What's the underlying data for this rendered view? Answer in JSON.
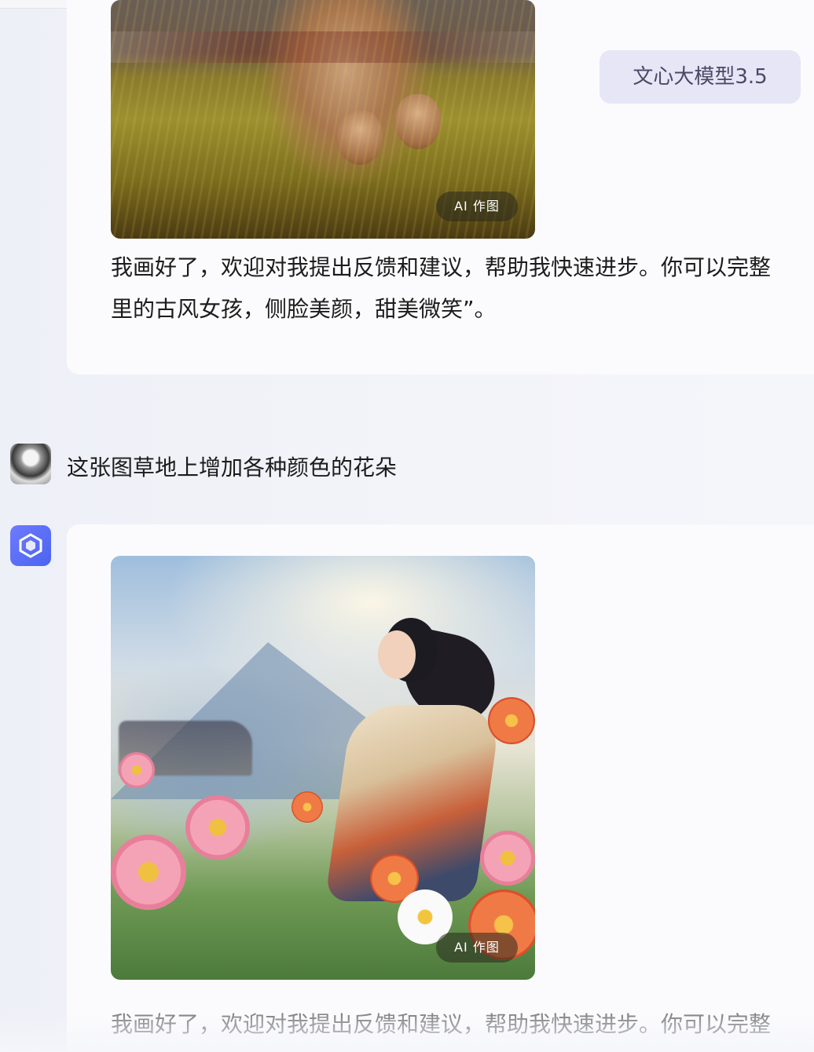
{
  "conversation": {
    "model_tag": "文心大模型3.5",
    "first_reply": {
      "image_badge": "AI 作图",
      "text_line1": "我画好了，欢迎对我提出反馈和建议，帮助我快速进步。你可以完整",
      "text_line2": "里的古风女孩，侧脸美颜，甜美微笑”。"
    },
    "user_message": {
      "text": "这张图草地上增加各种颜色的花朵"
    },
    "second_reply": {
      "image_badge": "AI 作图",
      "text_line1": "我画好了，欢迎对我提出反馈和建议，帮助我快速进步。你可以完整"
    }
  },
  "icons": {
    "user_avatar": "user-avatar-illustration",
    "bot_avatar": "cube-logo-icon"
  },
  "colors": {
    "bot_avatar": "#5a6cf5",
    "model_tag_bg": "#e6e6f6"
  }
}
